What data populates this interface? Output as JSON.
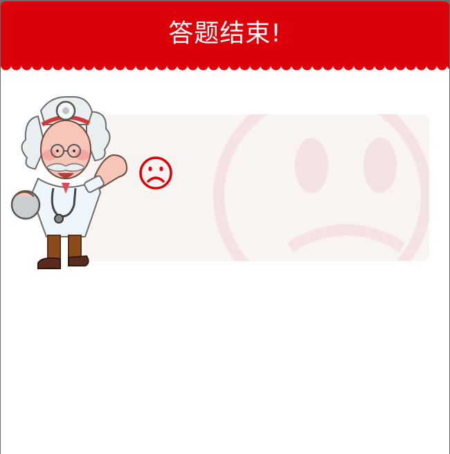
{
  "dialog": {
    "title": "答题结束!"
  },
  "result": {
    "face_icon": "sad-face-icon",
    "illustration": "doctor-mascot"
  },
  "colors": {
    "header_red": "#dc0008",
    "panel_bg": "#f8f4f2",
    "watermark": "#f5e2e2"
  }
}
